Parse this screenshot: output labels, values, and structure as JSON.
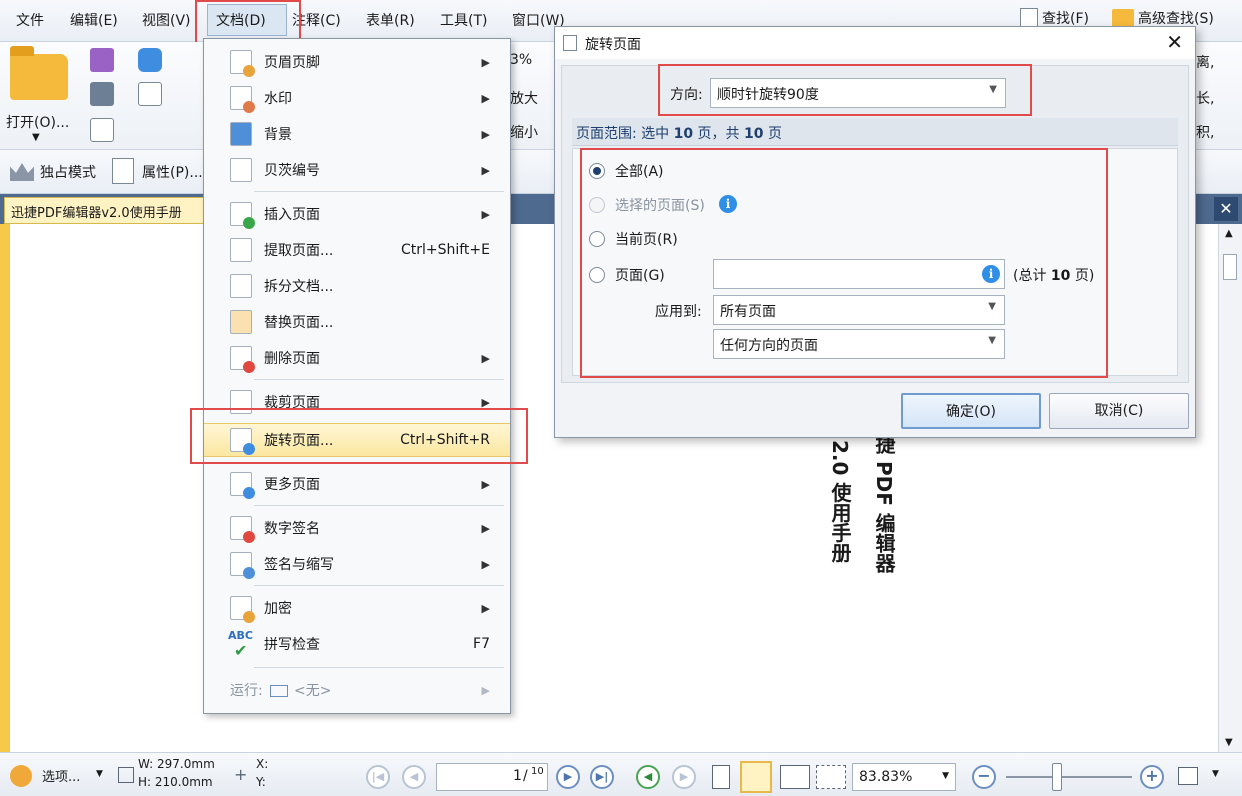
{
  "menubar": {
    "items": [
      "文件",
      "编辑(E)",
      "视图(V)",
      "文档(D)",
      "注释(C)",
      "表单(R)",
      "工具(T)",
      "窗口(W)"
    ],
    "find": "查找(F)",
    "advanced_find": "高级查找(S)"
  },
  "ribbon": {
    "open_label": "打开(O)...",
    "zoom_partial": "3%",
    "zoom_in_partial": "放大",
    "zoom_out_partial": "缩小",
    "right_partial_1": "离,",
    "right_partial_2": "长,",
    "right_partial_3": "积,"
  },
  "toolbar2": {
    "exclusive_mode": "独占模式",
    "properties": "属性(P)..."
  },
  "doc_tab": {
    "title": "迅捷PDF编辑器v2.0使用手册"
  },
  "document": {
    "line1": "捷 PDF 编辑器",
    "line2": "2.0 使用手册"
  },
  "dropdown": {
    "items": [
      {
        "label": "页眉页脚",
        "shortcut": "",
        "submenu": true
      },
      {
        "label": "水印",
        "shortcut": "",
        "submenu": true
      },
      {
        "label": "背景",
        "shortcut": "",
        "submenu": true
      },
      {
        "label": "贝茨编号",
        "shortcut": "",
        "submenu": true
      },
      {
        "label": "插入页面",
        "shortcut": "",
        "submenu": true
      },
      {
        "label": "提取页面...",
        "shortcut": "Ctrl+Shift+E",
        "submenu": false
      },
      {
        "label": "拆分文档...",
        "shortcut": "",
        "submenu": false
      },
      {
        "label": "替换页面...",
        "shortcut": "",
        "submenu": false
      },
      {
        "label": "删除页面",
        "shortcut": "",
        "submenu": true
      },
      {
        "label": "裁剪页面",
        "shortcut": "",
        "submenu": true
      },
      {
        "label": "旋转页面...",
        "shortcut": "Ctrl+Shift+R",
        "submenu": false
      },
      {
        "label": "更多页面",
        "shortcut": "",
        "submenu": true
      },
      {
        "label": "数字签名",
        "shortcut": "",
        "submenu": true
      },
      {
        "label": "签名与缩写",
        "shortcut": "",
        "submenu": true
      },
      {
        "label": "加密",
        "shortcut": "",
        "submenu": true
      },
      {
        "label": "拼写检查",
        "shortcut": "F7",
        "submenu": false
      }
    ],
    "run_label": "运行:",
    "run_value": "<无>",
    "abc": "ABC"
  },
  "dialog": {
    "title": "旋转页面",
    "direction_label": "方向:",
    "direction_value": "顺时针旋转90度",
    "range_prefix": "页面范围: 选中 ",
    "range_selected": "10",
    "range_mid": " 页，共 ",
    "range_total": "10",
    "range_suffix": " 页",
    "radio_all": "全部(A)",
    "radio_selected": "选择的页面(S)",
    "radio_current": "当前页(R)",
    "radio_pages": "页面(G)",
    "pages_input": "",
    "total_prefix": "(总计 ",
    "total_count": "10",
    "total_suffix": " 页)",
    "apply_label": "应用到:",
    "apply_value": "所有页面",
    "orientation_value": "任何方向的页面",
    "ok": "确定(O)",
    "cancel": "取消(C)"
  },
  "statusbar": {
    "options": "选项...",
    "width": "W: 297.0mm",
    "height": "H: 210.0mm",
    "x": "X:",
    "y": "Y:",
    "page_current": "1",
    "page_total": "10",
    "zoom": "83.83%"
  },
  "colors": {
    "highlight": "#e04a4a",
    "accent_tab": "#f7c948",
    "menu_hover": "#fbe7a1"
  }
}
